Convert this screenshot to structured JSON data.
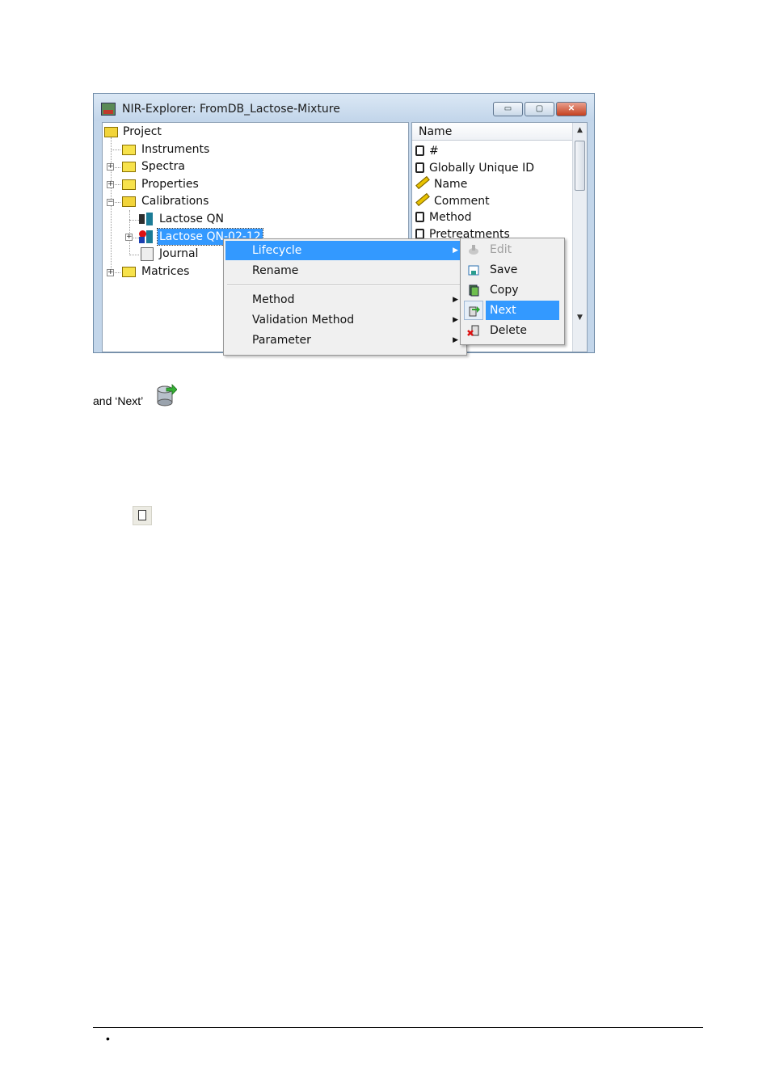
{
  "window": {
    "title": "NIR-Explorer: FromDB_Lactose-Mixture",
    "min_label": "▭",
    "max_label": "▢",
    "close_label": "✕"
  },
  "tree": {
    "root": "Project",
    "items": [
      {
        "label": "Instruments"
      },
      {
        "label": "Spectra"
      },
      {
        "label": "Properties"
      },
      {
        "label": "Calibrations"
      },
      {
        "label": "Lactose QN"
      },
      {
        "label": "Lactose QN-02-12"
      },
      {
        "label": "Journal"
      },
      {
        "label": "Matrices"
      }
    ]
  },
  "properties": {
    "column_header": "Name",
    "rows": [
      {
        "label": "#"
      },
      {
        "label": "Globally Unique ID"
      },
      {
        "label": "Name"
      },
      {
        "label": "Comment"
      },
      {
        "label": "Method"
      },
      {
        "label": "Pretreatments"
      }
    ]
  },
  "context_menu": {
    "items": [
      {
        "label": "Lifecycle"
      },
      {
        "label": "Rename"
      },
      {
        "label": "Method"
      },
      {
        "label": "Validation Method"
      },
      {
        "label": "Parameter"
      }
    ]
  },
  "submenu": {
    "items": [
      {
        "label": "Edit"
      },
      {
        "label": "Save"
      },
      {
        "label": "Copy"
      },
      {
        "label": "Next"
      },
      {
        "label": "Delete"
      }
    ]
  },
  "document": {
    "caption": "and ‘Next’",
    "bullet": "•"
  }
}
